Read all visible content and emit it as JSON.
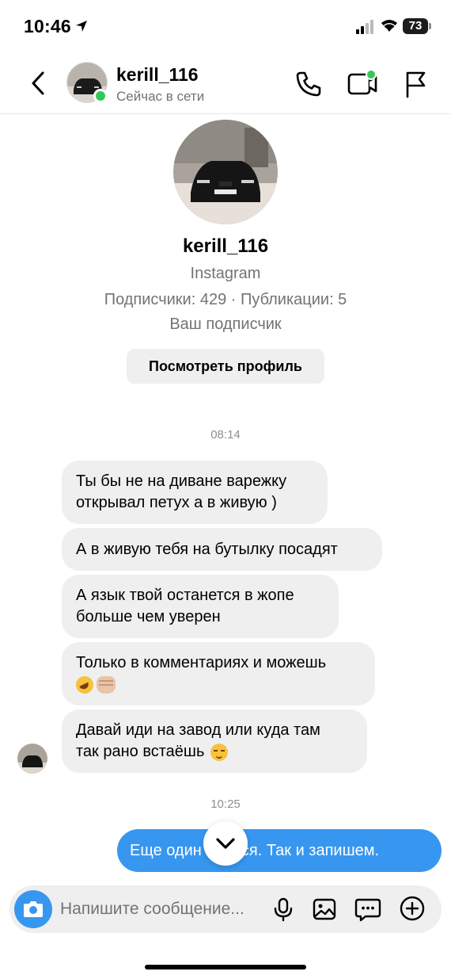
{
  "status_bar": {
    "time": "10:46",
    "battery": "73"
  },
  "header": {
    "username": "kerill_116",
    "status": "Сейчас в сети"
  },
  "profile": {
    "username": "kerill_116",
    "platform": "Instagram",
    "stats": "Подписчики: 429 · Публикации: 5",
    "follow_status": "Ваш подписчик",
    "view_profile_label": "Посмотреть профиль"
  },
  "timestamps": [
    "08:14",
    "10:25"
  ],
  "incoming_messages": [
    {
      "lines": [
        "Ты бы не на диване варежку",
        "открывал петух а в живую )"
      ]
    },
    {
      "lines": [
        "А в живую тебя на бутылку посадят"
      ]
    },
    {
      "lines": [
        "А язык твой останется в жопе",
        "больше чем уверен"
      ]
    },
    {
      "lines": [
        "Только в комментариях и можешь",
        ""
      ],
      "emojis": [
        "rolling-on-floor-laughing",
        "raised-fist-light-skin"
      ]
    },
    {
      "lines": [
        "Давай иди на завод или куда там",
        "так рано встаёшь"
      ],
      "emojis": [
        "relieved-face"
      ]
    }
  ],
  "outgoing_message": "Еще один слился. Так и запишем.",
  "composer": {
    "placeholder": "Напишите сообщение..."
  },
  "colors": {
    "accent_blue": "#3797f0",
    "online_green": "#34c759",
    "bubble_gray": "#efefef",
    "secondary_text": "#737373"
  }
}
